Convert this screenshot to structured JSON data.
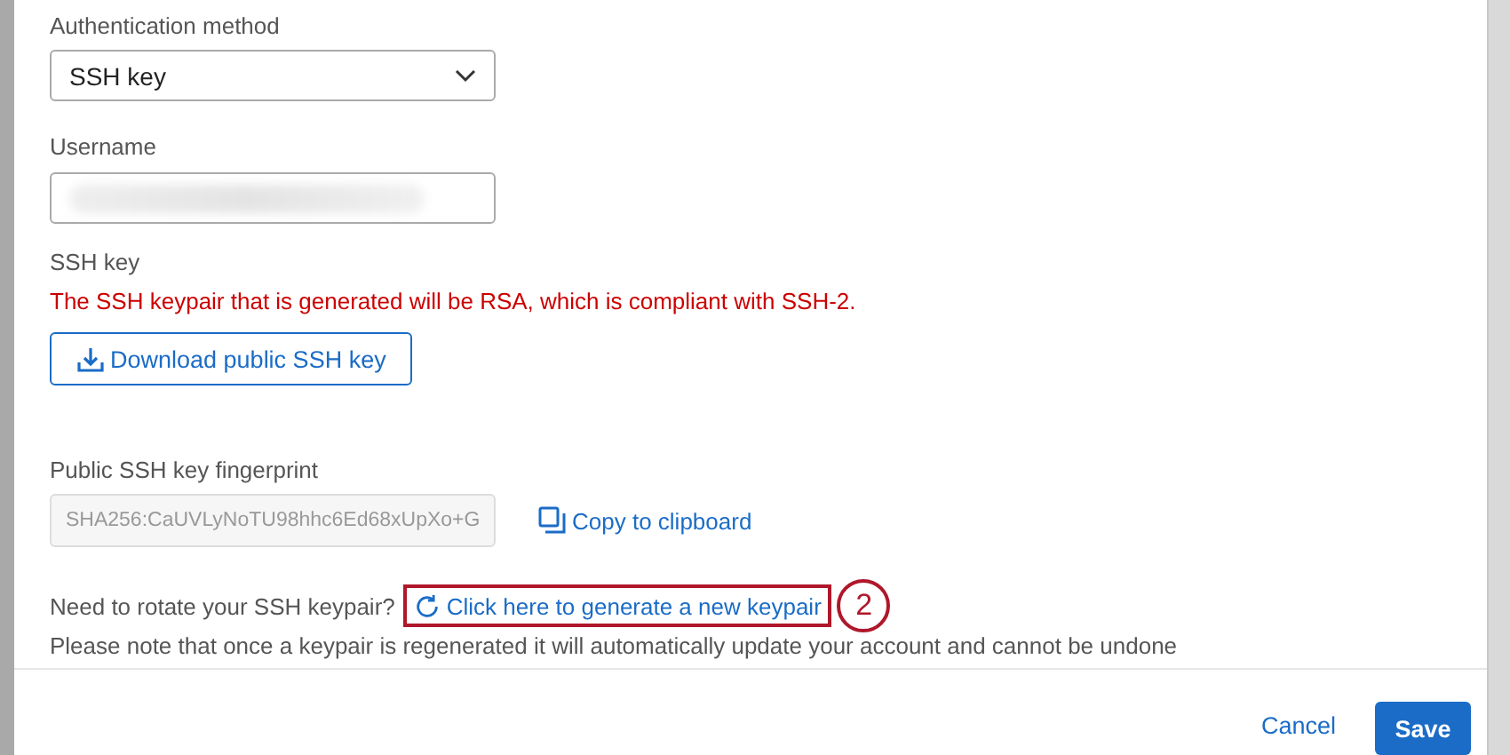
{
  "auth_method": {
    "label": "Authentication method",
    "value": "SSH key"
  },
  "username": {
    "label": "Username",
    "blurred": true
  },
  "ssh_key": {
    "label": "SSH key",
    "notice": "The SSH keypair that is generated will be RSA, which is compliant with SSH-2.",
    "download_button": "Download public SSH key"
  },
  "fingerprint": {
    "label": "Public SSH key fingerprint",
    "value": "SHA256:CaUVLyNoTU98hhc6Ed68xUpXo+G",
    "copy_link": "Copy to clipboard"
  },
  "rotate": {
    "question": "Need to rotate your SSH keypair?",
    "link": "Click here to generate a new keypair",
    "callout": "2",
    "note": "Please note that once a keypair is regenerated it will automatically update your account and cannot be undone"
  },
  "footer": {
    "cancel": "Cancel",
    "save": "Save"
  }
}
